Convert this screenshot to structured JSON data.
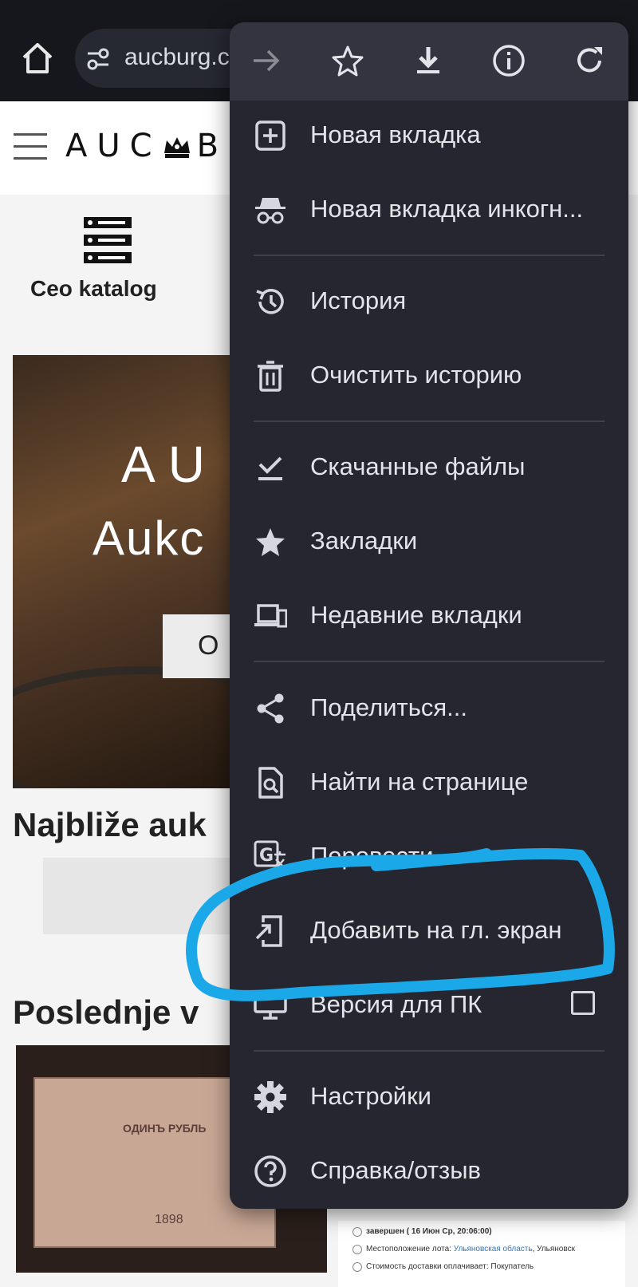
{
  "browser": {
    "url_text": "aucburg.c",
    "icons": [
      "home-icon",
      "site-settings-icon",
      "forward-icon",
      "bookmark-star-icon",
      "download-icon",
      "info-icon",
      "refresh-icon"
    ]
  },
  "page": {
    "logo_text_left": "AUC",
    "logo_text_right": "B",
    "category_label": "Ceo katalog",
    "hero_line1": "AU",
    "hero_line2": "Aukc",
    "hero_button": "O",
    "section_near": "Najbliže auk",
    "section_last": "Poslednje v",
    "banknote_title": "ОДИНЪ РУБЛЬ",
    "banknote_year": "1898",
    "lot_status": "завершен ( 16 Июн Ср, 20:06:00)",
    "lot_location_label": "Местоположение лота:",
    "lot_location_region": "Ульяновская область",
    "lot_location_city": ", Ульяновск",
    "lot_delivery": "Стоимость доставки оплачивает: Покупатель"
  },
  "menu": {
    "items": [
      {
        "label": "Новая вкладка",
        "icon": "new-tab-icon"
      },
      {
        "label": "Новая вкладка инкогн...",
        "icon": "incognito-icon"
      },
      {
        "label": "История",
        "icon": "history-icon"
      },
      {
        "label": "Очистить историю",
        "icon": "trash-icon"
      },
      {
        "label": "Скачанные файлы",
        "icon": "downloads-icon"
      },
      {
        "label": "Закладки",
        "icon": "bookmarks-star-icon"
      },
      {
        "label": "Недавние вкладки",
        "icon": "recent-tabs-icon"
      },
      {
        "label": "Поделиться...",
        "icon": "share-icon"
      },
      {
        "label": "Найти на странице",
        "icon": "find-in-page-icon"
      },
      {
        "label": "Перевести...",
        "icon": "translate-icon"
      },
      {
        "label": "Добавить на гл. экран",
        "icon": "add-to-home-screen-icon"
      },
      {
        "label": "Версия для ПК",
        "icon": "desktop-icon",
        "checked": false
      },
      {
        "label": "Настройки",
        "icon": "settings-gear-icon"
      },
      {
        "label": "Справка/отзыв",
        "icon": "help-icon"
      }
    ]
  },
  "colors": {
    "menu_bg": "#25262f",
    "menu_toolbar_bg": "#33343f",
    "menu_text": "#e3e4ea",
    "highlight_annotation": "#1aa8e8"
  }
}
